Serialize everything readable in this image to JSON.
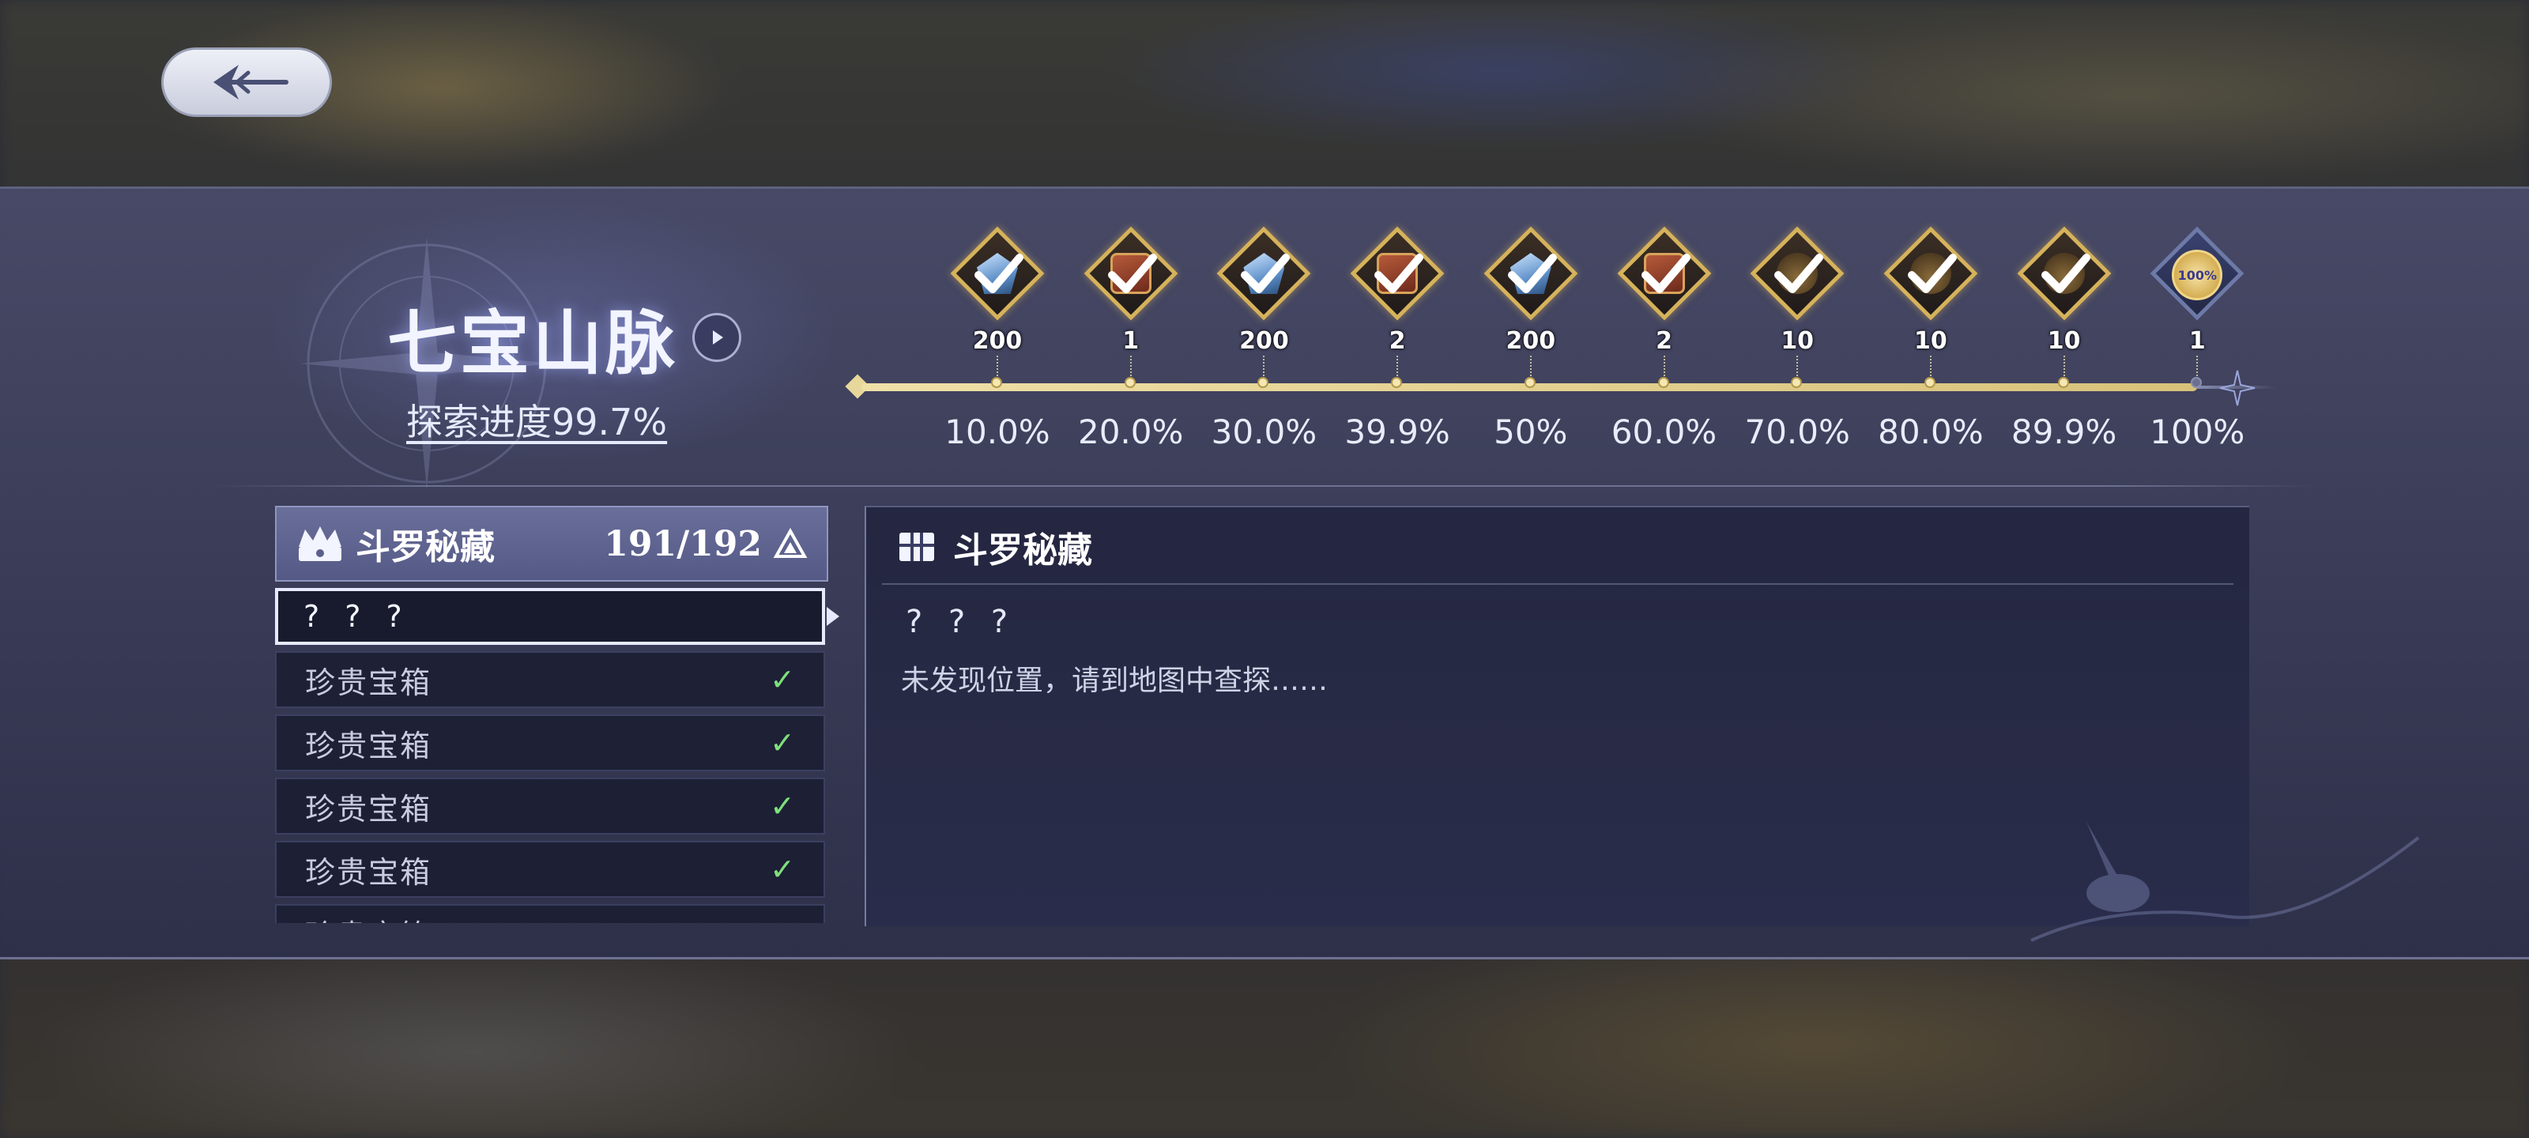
{
  "header": {
    "back_button_icon": "back-arrow-icon"
  },
  "area": {
    "title": "七宝山脉",
    "progress_text": "探索进度99.7%"
  },
  "milestones": [
    {
      "count": "200",
      "percent": "10.0%",
      "item": "gem",
      "claimed": true
    },
    {
      "count": "1",
      "percent": "20.0%",
      "item": "book",
      "claimed": true
    },
    {
      "count": "200",
      "percent": "30.0%",
      "item": "gem",
      "claimed": true
    },
    {
      "count": "2",
      "percent": "39.9%",
      "item": "book",
      "claimed": true
    },
    {
      "count": "200",
      "percent": "50%",
      "item": "gem",
      "claimed": true
    },
    {
      "count": "2",
      "percent": "60.0%",
      "item": "book",
      "claimed": true
    },
    {
      "count": "10",
      "percent": "70.0%",
      "item": "bag",
      "claimed": true
    },
    {
      "count": "10",
      "percent": "80.0%",
      "item": "bag",
      "claimed": true
    },
    {
      "count": "10",
      "percent": "89.9%",
      "item": "bag",
      "claimed": true
    },
    {
      "count": "1",
      "percent": "100%",
      "item": "badge",
      "claimed": false,
      "badge_text": "100%"
    }
  ],
  "list": {
    "title": "斗罗秘藏",
    "count": "191/192",
    "items": [
      {
        "label": "? ? ?",
        "checked": false,
        "selected": true
      },
      {
        "label": "珍贵宝箱",
        "checked": true
      },
      {
        "label": "珍贵宝箱",
        "checked": true
      },
      {
        "label": "珍贵宝箱",
        "checked": true
      },
      {
        "label": "珍贵宝箱",
        "checked": true
      },
      {
        "label": "珍贵宝箱",
        "checked": true
      }
    ],
    "check_glyph": "✓"
  },
  "detail": {
    "title": "斗罗秘藏",
    "name": "? ? ?",
    "description": "未发现位置，请到地图中查探……"
  },
  "colors": {
    "accent_gold": "#d6b25a",
    "check_green": "#7ee07a",
    "panel": "#4a4c6c"
  }
}
